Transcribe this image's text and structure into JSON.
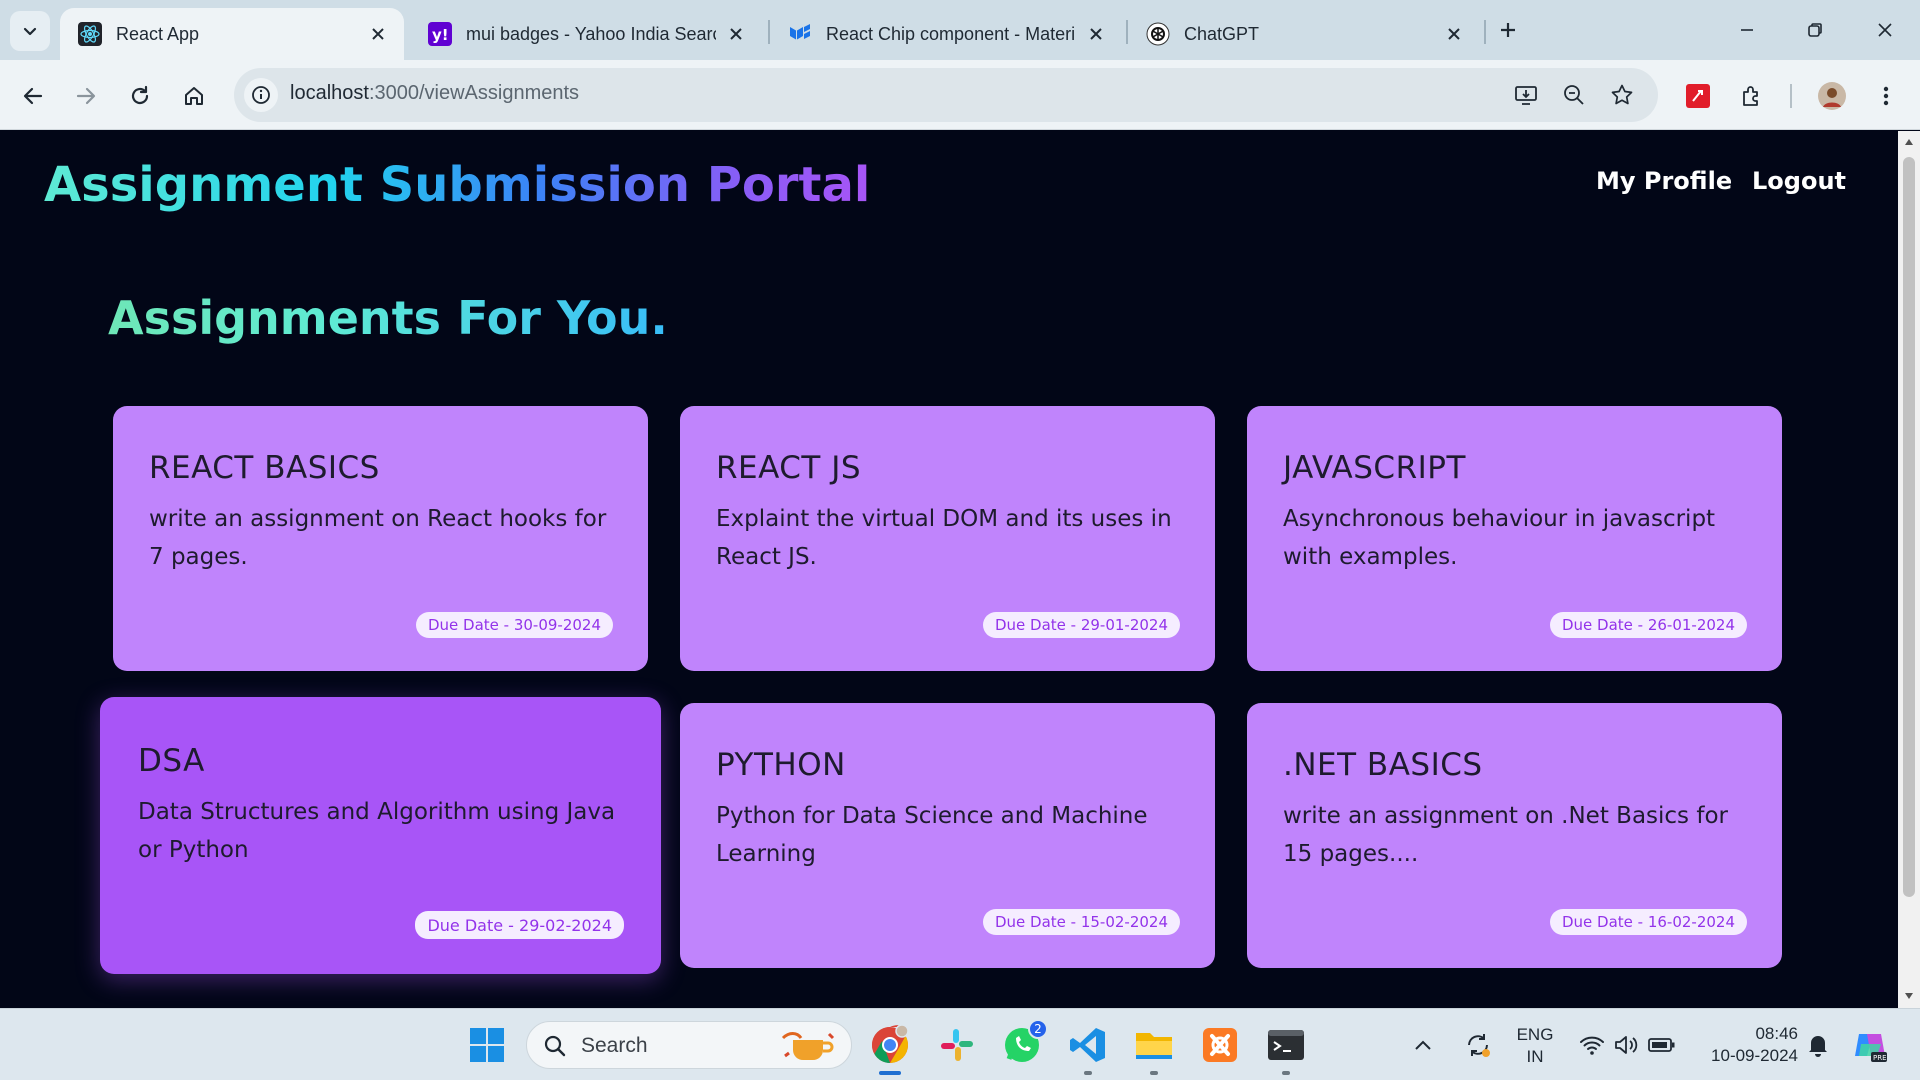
{
  "browser": {
    "tabs": [
      {
        "title": "React App",
        "active": true
      },
      {
        "title": "mui badges - Yahoo India Searc",
        "active": false
      },
      {
        "title": "React Chip component - Materi",
        "active": false
      },
      {
        "title": "ChatGPT",
        "active": false
      }
    ],
    "address": {
      "host": "localhost",
      "path": ":3000/viewAssignments"
    }
  },
  "app": {
    "brand": "Assignment Submission Portal",
    "nav": {
      "profile": "My Profile",
      "logout": "Logout"
    },
    "heading": "Assignments For You.",
    "assignments": [
      {
        "title": "REACT BASICS",
        "description": "write an assignment on React hooks for 7 pages.",
        "due": "Due Date - 30-09-2024"
      },
      {
        "title": "REACT JS",
        "description": "Explaint the virtual DOM and its uses in React JS.",
        "due": "Due Date - 29-01-2024"
      },
      {
        "title": "JAVASCRIPT",
        "description": "Asynchronous behaviour in javascript with examples.",
        "due": "Due Date - 26-01-2024"
      },
      {
        "title": "DSA",
        "description": "Data Structures and Algorithm using Java or Python",
        "due": "Due Date - 29-02-2024"
      },
      {
        "title": "PYTHON",
        "description": "Python for Data Science and Machine Learning",
        "due": "Due Date - 15-02-2024"
      },
      {
        "title": ".NET BASICS",
        "description": "write an assignment on .Net Basics for 15 pages....",
        "due": "Due Date - 16-02-2024"
      }
    ]
  },
  "taskbar": {
    "search_label": "Search",
    "whatsapp_badge": "2",
    "language": {
      "line1": "ENG",
      "line2": "IN"
    },
    "clock": {
      "time": "08:46",
      "date": "10-09-2024"
    }
  },
  "colors": {
    "page_bg": "#020617",
    "card": "#c084fc",
    "card_hover": "#a855f7",
    "chip_text": "#9333ea",
    "brand_gradient": [
      "#5eead4",
      "#3b82f6",
      "#a855f7"
    ]
  }
}
